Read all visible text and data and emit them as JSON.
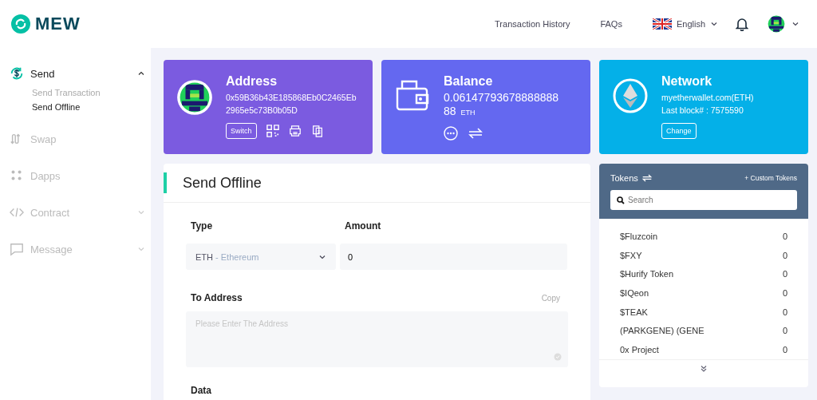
{
  "header": {
    "logo": "MEW",
    "nav": [
      "Transaction History",
      "FAQs"
    ],
    "language": "English"
  },
  "sidebar": {
    "items": [
      {
        "label": "Send",
        "selected": true,
        "expanded": true,
        "children": [
          {
            "label": "Send Transaction",
            "selected": false
          },
          {
            "label": "Send Offline",
            "selected": true
          }
        ]
      },
      {
        "label": "Swap",
        "selected": false
      },
      {
        "label": "Dapps",
        "selected": false
      },
      {
        "label": "Contract",
        "selected": false,
        "expanded": false
      },
      {
        "label": "Message",
        "selected": false,
        "expanded": false
      }
    ]
  },
  "address_card": {
    "title": "Address",
    "address": "0x59B36b43E185868Eb0C2465Eb2965e5c73B0b05D",
    "button": "Switch"
  },
  "balance_card": {
    "title": "Balance",
    "amount": "0.0614779367888888888",
    "unit": "ETH"
  },
  "network_card": {
    "title": "Network",
    "network": "myetherwallet.com(ETH)",
    "last_block": "Last block# : 7575590",
    "button": "Change"
  },
  "send_offline": {
    "title": "Send Offline",
    "type_label": "Type",
    "type_value": "ETH",
    "type_name": "- Ethereum",
    "amount_label": "Amount",
    "amount_value": "0",
    "to_label": "To Address",
    "copy": "Copy",
    "to_placeholder": "Please Enter The Address",
    "data_label": "Data"
  },
  "tokens": {
    "title": "Tokens",
    "custom": "+ Custom Tokens",
    "search_placeholder": "Search",
    "rows": [
      {
        "name": "$Fluzcoin",
        "balance": "0"
      },
      {
        "name": "$FXY",
        "balance": "0"
      },
      {
        "name": "$Hurify Token",
        "balance": "0"
      },
      {
        "name": "$IQeon",
        "balance": "0"
      },
      {
        "name": "$TEAK",
        "balance": "0"
      },
      {
        "name": "(PARKGENE) (GENE",
        "balance": "0"
      },
      {
        "name": "0x Project",
        "balance": "0"
      }
    ]
  }
}
